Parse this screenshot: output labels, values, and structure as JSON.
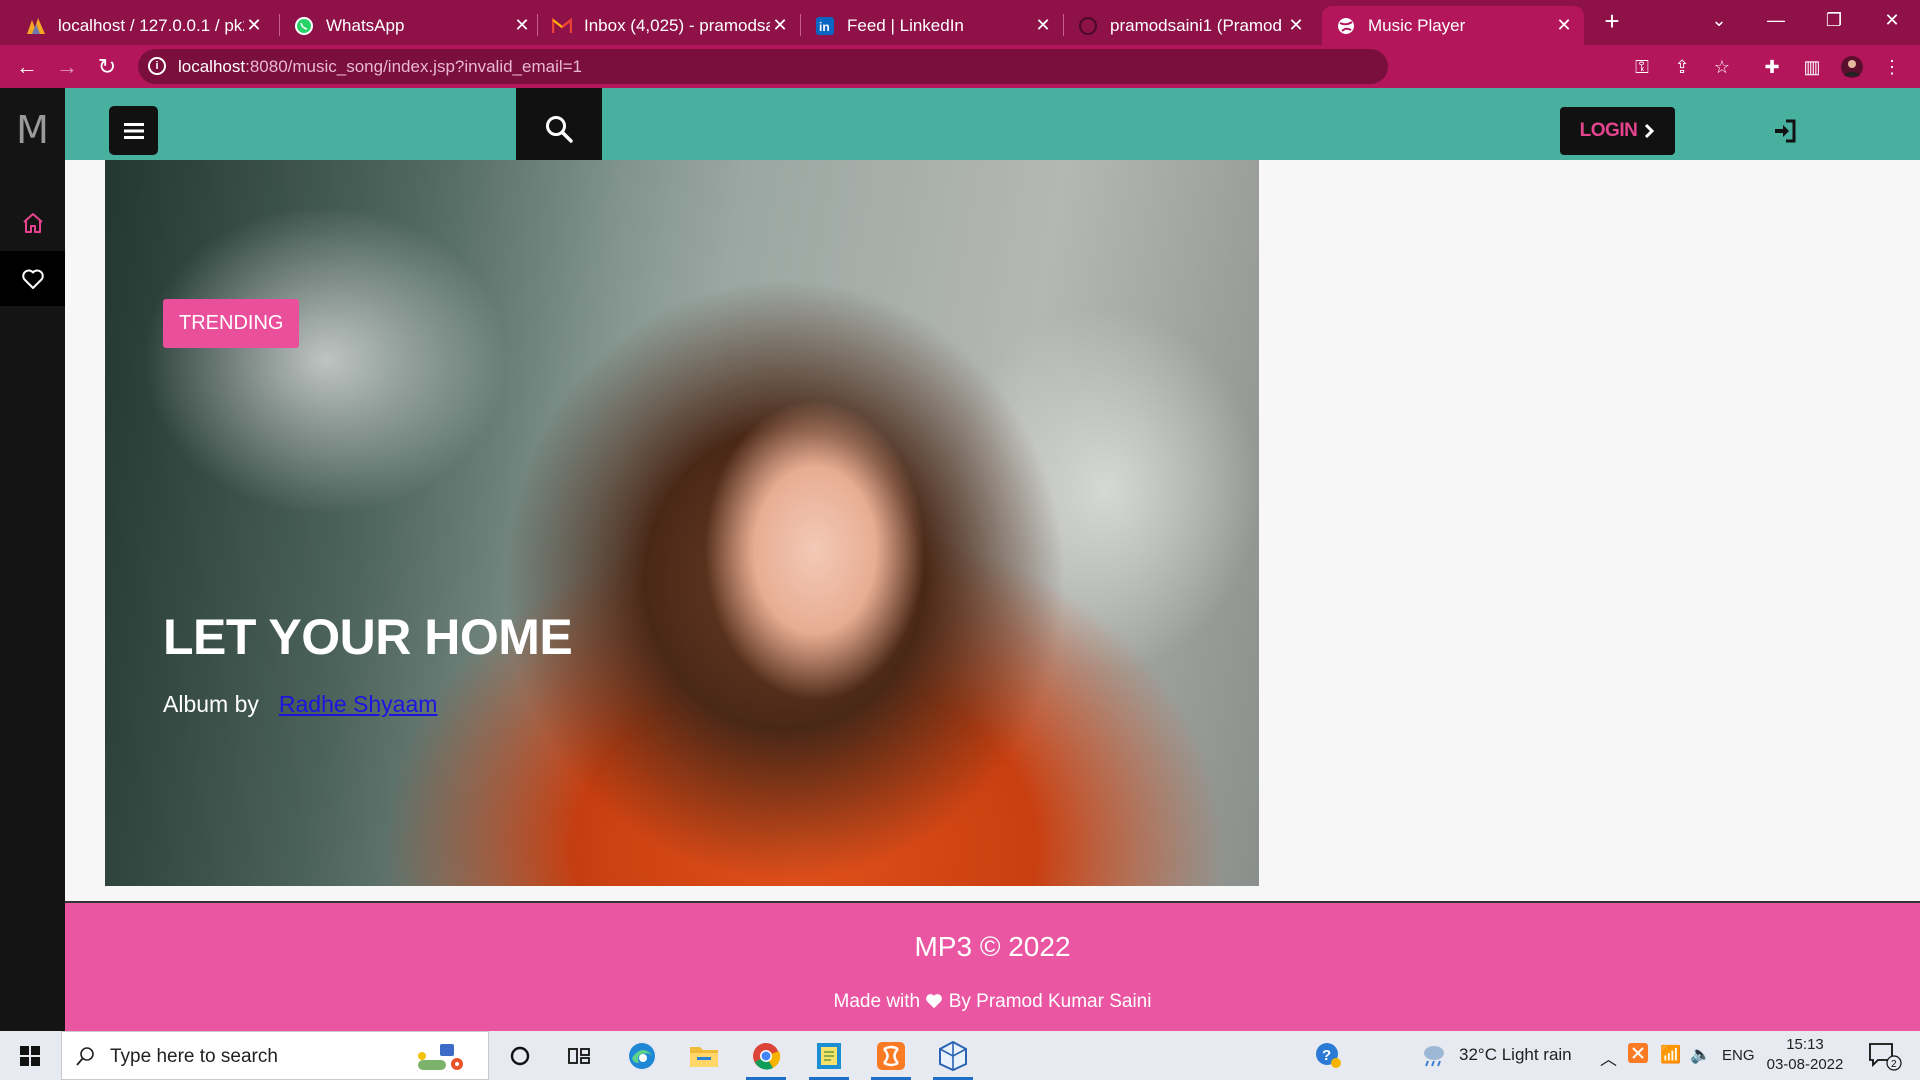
{
  "browser": {
    "tabs": [
      {
        "label": "localhost / 127.0.0.1 / pk2 /",
        "icon": "phpmyadmin-icon"
      },
      {
        "label": "WhatsApp",
        "icon": "whatsapp-icon"
      },
      {
        "label": "Inbox (4,025) - pramodsaini",
        "icon": "gmail-icon"
      },
      {
        "label": "Feed | LinkedIn",
        "icon": "linkedin-icon"
      },
      {
        "label": "pramodsaini1 (Pramod Kum",
        "icon": "github-icon"
      },
      {
        "label": "Music Player",
        "icon": "globe-icon"
      }
    ],
    "active_tab": 5,
    "url_host": "localhost",
    "url_path": ":8080/music_song/index.jsp?invalid_email=1"
  },
  "app": {
    "logo": "M",
    "login_label": "LOGIN",
    "hero": {
      "badge": "TRENDING",
      "title": "LET YOUR HOME",
      "album_prefix": "Album by",
      "artist": "Radhe Shyaam"
    },
    "footer": {
      "copyright": "MP3 © 2022",
      "made_prefix": "Made with",
      "made_suffix": "By Pramod Kumar Saini"
    },
    "colors": {
      "header": "#47b09e",
      "accent": "#ea4f9b",
      "browser": "#b3165b"
    }
  },
  "taskbar": {
    "search_placeholder": "Type here to search",
    "weather": "32°C  Light rain",
    "language": "ENG",
    "time": "15:13",
    "date": "03-08-2022",
    "notifications": "2"
  }
}
